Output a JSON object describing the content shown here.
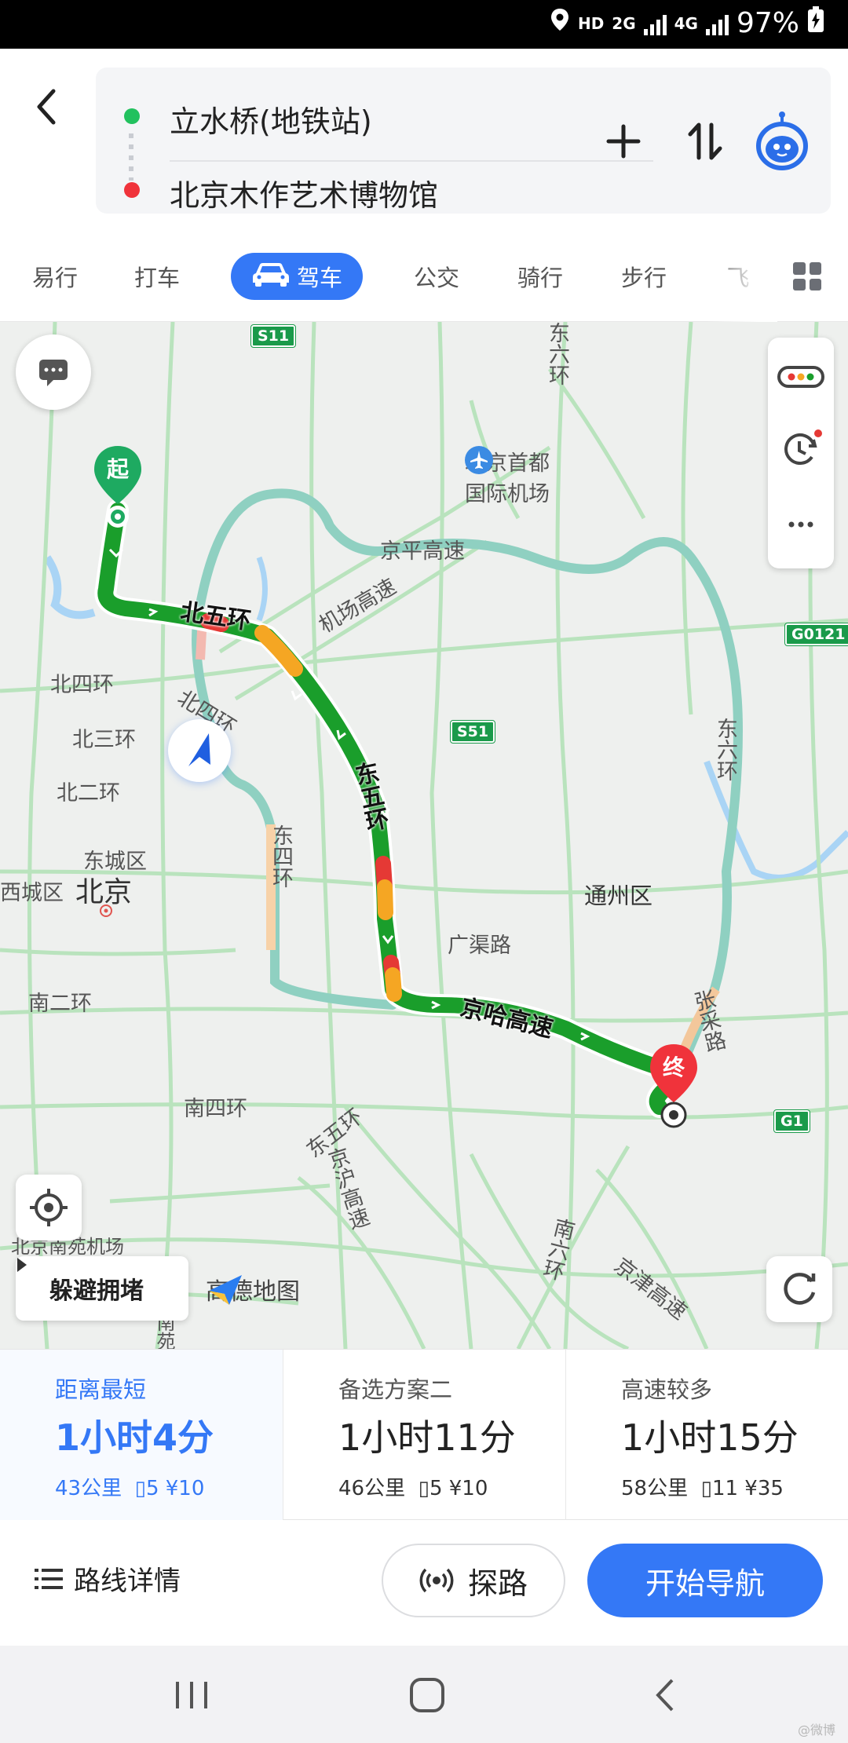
{
  "status_bar": {
    "net_hd": "HD",
    "net_2g": "2G",
    "net_4g": "4G",
    "battery": "97%"
  },
  "route": {
    "origin": "立水桥(地铁站)",
    "destination": "北京木作艺术博物馆"
  },
  "tabs": [
    {
      "label": "易行"
    },
    {
      "label": "打车"
    },
    {
      "label": "驾车",
      "active": true
    },
    {
      "label": "公交"
    },
    {
      "label": "骑行"
    },
    {
      "label": "步行"
    },
    {
      "label": "飞"
    }
  ],
  "map": {
    "start_marker": "起",
    "end_marker": "终",
    "road_labels": {
      "beiwuhuan": "北五环",
      "dongwuhuan": "东五环",
      "jingha": "京哈高速",
      "jingping": "京平高速",
      "jichang": "机场高速",
      "beisihuan_diag": "北四环",
      "beisihuan": "北四环",
      "beisanhuan": "北三环",
      "beierhuan": "北二环",
      "dongsihuan": "东四环",
      "dongliuhuan_top": "东六环",
      "dongliuhuan": "东六环",
      "guangqu": "广渠路",
      "nanerhuan": "南二环",
      "nansihuan": "南四环",
      "dongwuhuan_s": "东五环",
      "jinghu": "京沪高速",
      "nanliuhuan": "南六环",
      "zhangcai": "张采路",
      "jingjin": "京津高速"
    },
    "places": {
      "beijing": "北京",
      "dongcheng": "东城区",
      "xicheng": "西城区",
      "tongzhou": "通州区",
      "airport_line1": "北京首都",
      "airport_line2": "国际机场",
      "nanyuan": "北京南苑机场",
      "nanyuan_road": "南苑路"
    },
    "shields": {
      "s11": "S11",
      "s51": "S51",
      "g0121": "G0121",
      "g1": "G1"
    },
    "avoid_label": "躲避拥堵",
    "logo_text": "高德地图"
  },
  "options": [
    {
      "kind": "距离最短",
      "time": "1小时4分",
      "distance": "43公里",
      "lights": "5",
      "toll": "¥10",
      "selected": true
    },
    {
      "kind": "备选方案二",
      "time": "1小时11分",
      "distance": "46公里",
      "lights": "5",
      "toll": "¥10"
    },
    {
      "kind": "高速较多",
      "time": "1小时15分",
      "distance": "58公里",
      "lights": "11",
      "toll": "¥35"
    }
  ],
  "actions": {
    "details": "路线详情",
    "explore": "探路",
    "navigate": "开始导航"
  },
  "watermark": "@微博"
}
